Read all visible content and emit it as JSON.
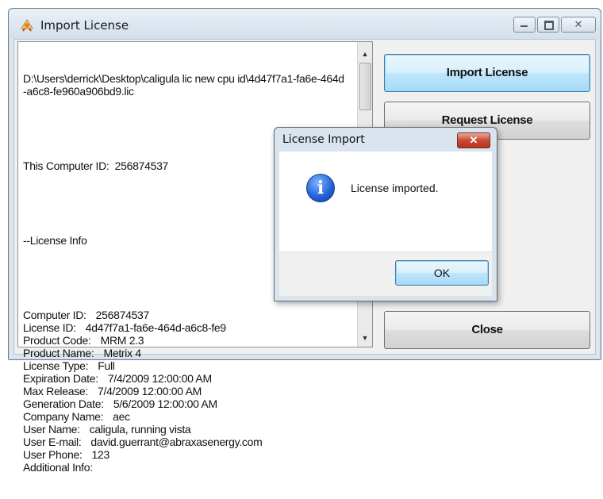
{
  "window": {
    "title": "Import License",
    "icon": "app-icon-certificate"
  },
  "license_text": {
    "path": "D:\\Users\\derrick\\Desktop\\caligula lic new cpu id\\4d47f7a1-fa6e-464d-a6c8-fe960a906bd9.lic",
    "computer_id_line": "This Computer ID:  256874537",
    "section_header": "--License Info",
    "fields": [
      {
        "label": "Computer ID:",
        "value": "256874537"
      },
      {
        "label": "License ID:",
        "value": "4d47f7a1-fa6e-464d-a6c8-fe9"
      },
      {
        "label": "Product Code:",
        "value": "MRM 2.3"
      },
      {
        "label": "Product Name:",
        "value": "Metrix 4"
      },
      {
        "label": "License Type:",
        "value": "Full"
      },
      {
        "label": "Expiration Date:",
        "value": "7/4/2009 12:00:00 AM"
      },
      {
        "label": "Max Release:",
        "value": "7/4/2009 12:00:00 AM"
      },
      {
        "label": "Generation Date:",
        "value": "5/6/2009 12:00:00 AM"
      },
      {
        "label": "Company Name:",
        "value": "aec"
      },
      {
        "label": "User Name:",
        "value": "caligula, running vista"
      },
      {
        "label": "User E-mail:",
        "value": "david.guerrant@abraxasenergy.com"
      },
      {
        "label": "User Phone:",
        "value": "123"
      },
      {
        "label": "Additional Info:",
        "value": ""
      }
    ]
  },
  "buttons": {
    "import": "Import License",
    "request": "Request License",
    "close": "Close"
  },
  "dialog": {
    "title": "License Import",
    "close_glyph": "✕",
    "icon": "info-icon",
    "icon_glyph": "i",
    "message": "License imported.",
    "ok": "OK"
  }
}
